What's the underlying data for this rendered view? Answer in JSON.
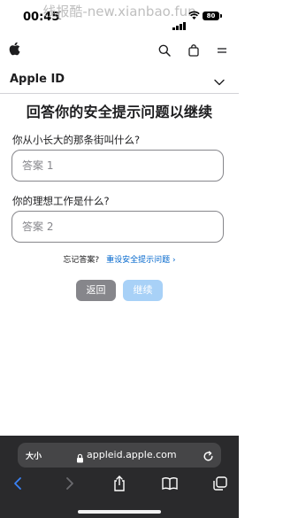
{
  "status_bar": {
    "time": "00:45",
    "watermark": "线报酷-new.xianbao.fun",
    "battery": "80"
  },
  "nav": {
    "logo_glyph": "",
    "icons": [
      "search-icon",
      "shopping-bag-icon",
      "menu-icon"
    ]
  },
  "subnav": {
    "title": "Apple ID"
  },
  "form": {
    "title": "回答你的安全提示问题以继续",
    "question1": "你从小长大的那条街叫什么?",
    "answer1_placeholder": "答案 1",
    "question2": "你的理想工作是什么?",
    "answer2_placeholder": "答案 2",
    "forgot_label": "忘记答案?",
    "reset_link": "重设安全提示问题 ›",
    "back_button": "返回",
    "continue_button": "继续"
  },
  "browser": {
    "text_size_label": "大小",
    "url": "appleid.apple.com"
  },
  "colors": {
    "link": "#0066cc",
    "back_button": "#86868b",
    "continue_button_disabled": "#a8d1f7",
    "toolbar_bg": "#2a2a2c"
  }
}
